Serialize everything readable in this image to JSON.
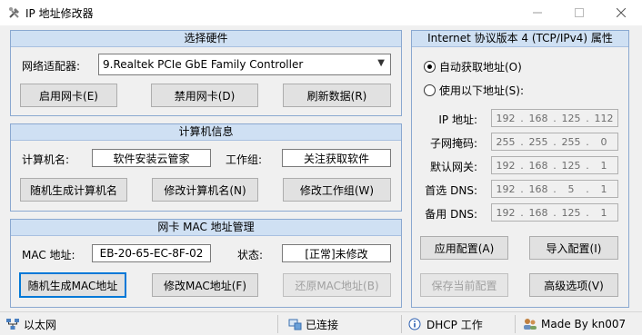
{
  "window": {
    "title": "IP 地址修改器"
  },
  "hardware": {
    "title": "选择硬件",
    "adapter_label": "网络适配器:",
    "adapter_value": "9.Realtek PCIe GbE Family Controller",
    "enable_button": "启用网卡(E)",
    "disable_button": "禁用网卡(D)",
    "refresh_button": "刷新数据(R)"
  },
  "computer": {
    "title": "计算机信息",
    "name_label": "计算机名:",
    "name_value": "软件安装云管家",
    "workgroup_label": "工作组:",
    "workgroup_value": "关注获取软件",
    "random_name_button": "随机生成计算机名",
    "change_name_button": "修改计算机名(N)",
    "change_workgroup_button": "修改工作组(W)"
  },
  "mac": {
    "title": "网卡 MAC 地址管理",
    "mac_label": "MAC 地址:",
    "mac_value": "EB-20-65-EC-8F-02",
    "status_label": "状态:",
    "status_value": "[正常]未修改",
    "random_mac_button": "随机生成MAC地址",
    "change_mac_button": "修改MAC地址(F)",
    "restore_mac_button": "还原MAC地址(B)"
  },
  "ipv4": {
    "title": "Internet 协议版本 4 (TCP/IPv4) 属性",
    "auto_radio": "自动获取地址(O)",
    "manual_radio": "使用以下地址(S):",
    "selected": "auto",
    "ip_label": "IP 地址:",
    "mask_label": "子网掩码:",
    "gateway_label": "默认网关:",
    "dns1_label": "首选 DNS:",
    "dns2_label": "备用 DNS:",
    "ip": [
      "192",
      "168",
      "125",
      "112"
    ],
    "mask": [
      "255",
      "255",
      "255",
      "0"
    ],
    "gateway": [
      "192",
      "168",
      "125",
      "1"
    ],
    "dns1": [
      "192",
      "168",
      "5",
      "1"
    ],
    "dns2": [
      "192",
      "168",
      "125",
      "1"
    ],
    "apply_button": "应用配置(A)",
    "import_button": "导入配置(I)",
    "save_button": "保存当前配置",
    "advanced_button": "高级选项(V)"
  },
  "status": {
    "network": "以太网",
    "connection": "已连接",
    "dhcp": "DHCP 工作",
    "author": "Made By kn007"
  },
  "icons": {
    "app": "tools-icon",
    "network": "network-icon",
    "connected": "connected-icon",
    "dhcp": "info-icon",
    "author": "users-icon"
  },
  "colors": {
    "panel_header": "#cfe0f3",
    "panel_border": "#8aa8d0",
    "focus": "#0078d7"
  }
}
